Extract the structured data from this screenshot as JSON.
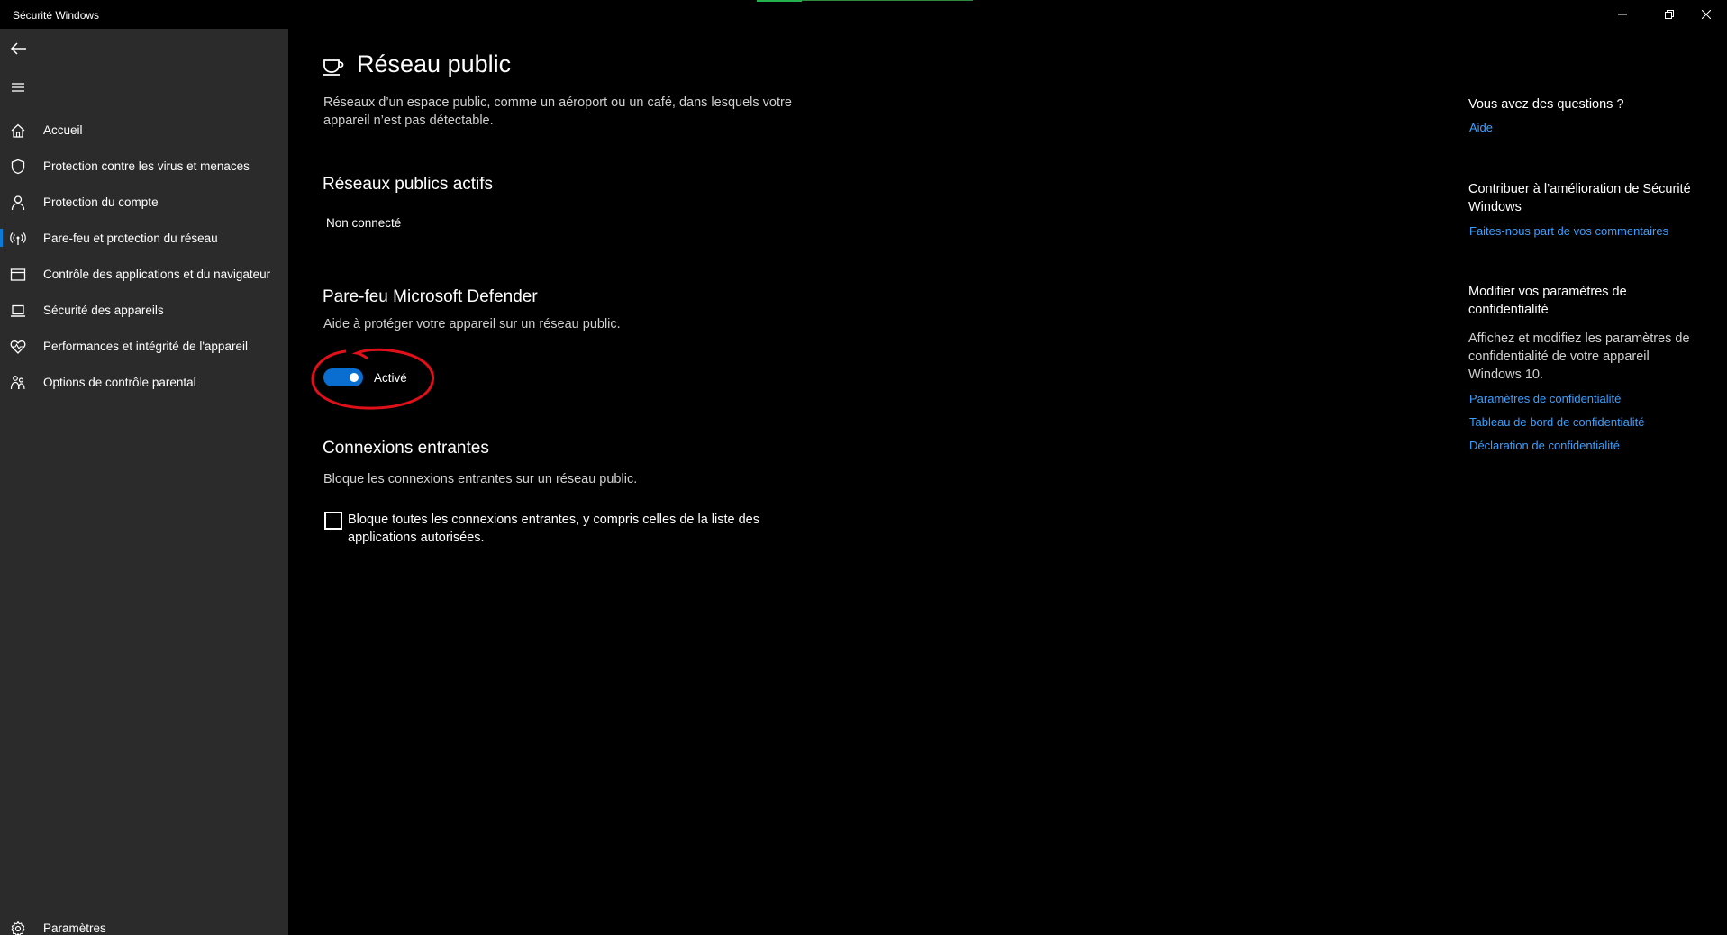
{
  "window": {
    "title": "Sécurité Windows"
  },
  "sidebar": {
    "items": [
      {
        "label": "Accueil",
        "icon": "home-icon"
      },
      {
        "label": "Protection contre les virus et menaces",
        "icon": "shield-icon"
      },
      {
        "label": "Protection du compte",
        "icon": "person-icon"
      },
      {
        "label": "Pare-feu et protection du réseau",
        "icon": "antenna-icon",
        "active": true
      },
      {
        "label": "Contrôle des applications et du navigateur",
        "icon": "browser-icon"
      },
      {
        "label": "Sécurité des appareils",
        "icon": "laptop-icon"
      },
      {
        "label": "Performances et intégrité de l'appareil",
        "icon": "heart-icon"
      },
      {
        "label": "Options de contrôle parental",
        "icon": "family-icon"
      }
    ],
    "settings_label": "Paramètres"
  },
  "main": {
    "title": "Réseau public",
    "description": "Réseaux d’un espace public, comme un aéroport ou un café, dans lesquels votre appareil n’est pas détectable.",
    "active_networks": {
      "heading": "Réseaux publics actifs",
      "value": "Non connecté"
    },
    "firewall": {
      "heading": "Pare-feu Microsoft Defender",
      "description": "Aide à protéger votre appareil sur un réseau public.",
      "toggle_on": true,
      "toggle_label": "Activé"
    },
    "incoming": {
      "heading": "Connexions entrantes",
      "description": "Bloque les connexions entrantes sur un réseau public.",
      "checkbox_checked": false,
      "checkbox_label": "Bloque toutes les connexions entrantes, y compris celles de la liste des applications autorisées."
    }
  },
  "right_panel": {
    "questions": {
      "heading": "Vous avez des questions ?",
      "link": "Aide"
    },
    "contribute": {
      "heading": "Contribuer à l’amélioration de Sécurité Windows",
      "link": "Faites-nous part de vos commentaires"
    },
    "privacy": {
      "heading": "Modifier vos paramètres de confidentialité",
      "text": "Affichez et modifiez les paramètres de confidentialité de votre appareil Windows 10.",
      "links": [
        "Paramètres de confidentialité",
        "Tableau de bord de confidentialité",
        "Déclaration de confidentialité"
      ]
    }
  },
  "colors": {
    "accent": "#0a6ed1",
    "link": "#3aa0ff",
    "sidebar_bg": "#2b2b2b",
    "annotation": "#e0101a"
  }
}
